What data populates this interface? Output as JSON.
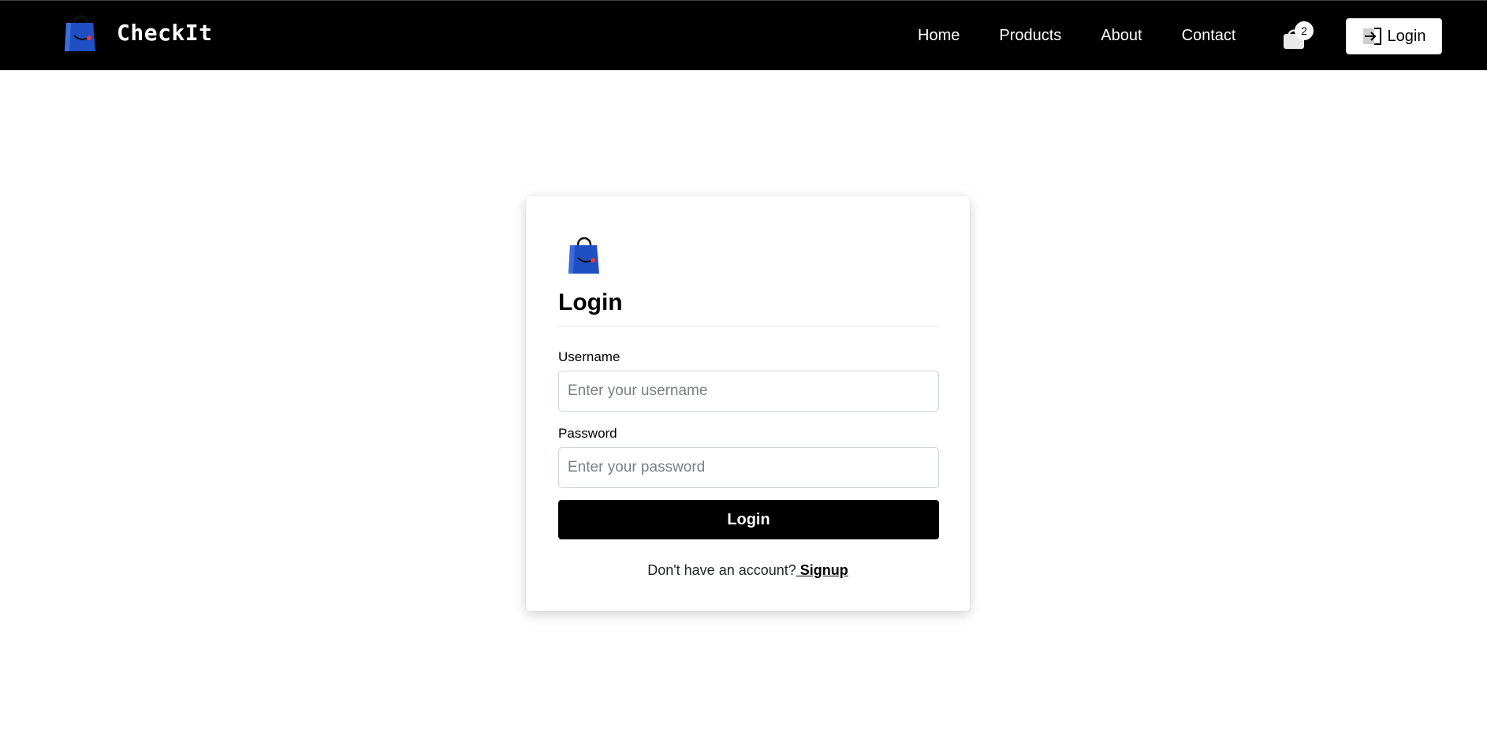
{
  "brand": {
    "name": "CheckIt",
    "logo_icon": "shopping-bag-icon"
  },
  "nav": {
    "links": [
      "Home",
      "Products",
      "About",
      "Contact"
    ],
    "cart_count": "2",
    "cart_icon": "shopping-bag-icon",
    "login_label": "Login",
    "login_icon": "sign-in-icon"
  },
  "form": {
    "title": "Login",
    "username_label": "Username",
    "username_placeholder": "Enter your username",
    "password_label": "Password",
    "password_placeholder": "Enter your password",
    "submit_label": "Login",
    "signup_prompt": "Don't have an account?",
    "signup_link": " Signup"
  },
  "colors": {
    "navbar": "#000000",
    "logo_blue": "#1f4fc2",
    "accent": "#000000"
  }
}
